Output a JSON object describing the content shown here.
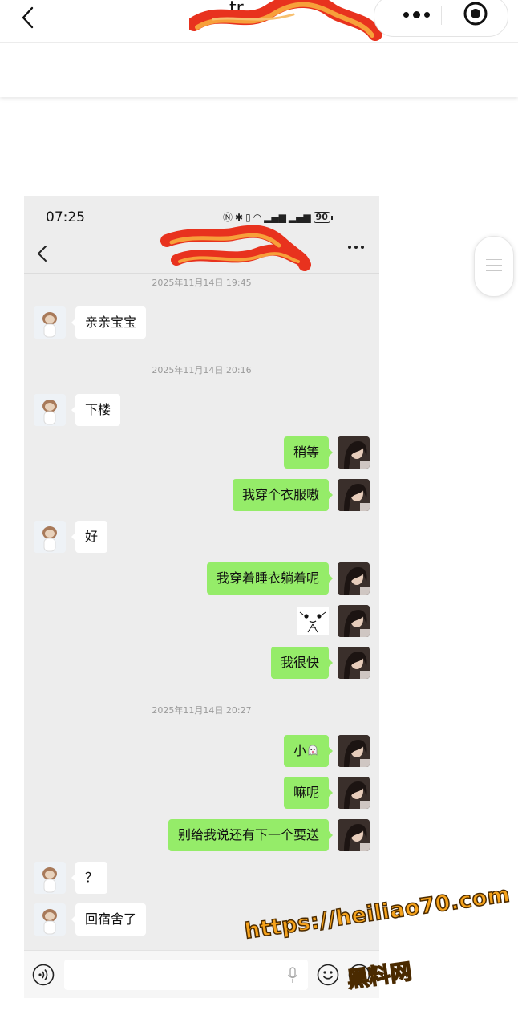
{
  "outer": {
    "title_fragment": "tr",
    "colors": {
      "header_bg": "#ffffff",
      "scribble": "#e8321e",
      "scribble_inner": "#f7a03a"
    }
  },
  "phone": {
    "status": {
      "time": "07:25",
      "battery": "90"
    },
    "colors": {
      "chat_bg": "#ededed",
      "self_bubble": "#95ec69",
      "other_bubble": "#ffffff",
      "timestamp": "#9b9b9b"
    }
  },
  "chat": {
    "timestamps": [
      "2025年11月14日 19:45",
      "2025年11月14日 20:16",
      "2025年11月14日 20:27"
    ],
    "messages": [
      {
        "from": "other",
        "text": "亲亲宝宝"
      },
      {
        "from": "other",
        "text": "下楼"
      },
      {
        "from": "self",
        "text": "稍等"
      },
      {
        "from": "self",
        "text": "我穿个衣服嗷"
      },
      {
        "from": "other",
        "text": "好"
      },
      {
        "from": "self",
        "text": "我穿着睡衣躺着呢"
      },
      {
        "from": "self",
        "text": "",
        "type": "sticker",
        "icon": "cat-sticker-icon"
      },
      {
        "from": "self",
        "text": "我很快"
      },
      {
        "from": "self",
        "text": "小",
        "icon": "ghost-emoji-icon"
      },
      {
        "from": "self",
        "text": "嘛呢"
      },
      {
        "from": "self",
        "text": "别给我说还有下一个要送"
      },
      {
        "from": "other",
        "text": "？"
      },
      {
        "from": "other",
        "text": "回宿舍了"
      }
    ]
  },
  "input": {
    "value": "",
    "placeholder": ""
  },
  "watermark": {
    "url": "https://heiliao70.com",
    "name": "黑料网"
  }
}
